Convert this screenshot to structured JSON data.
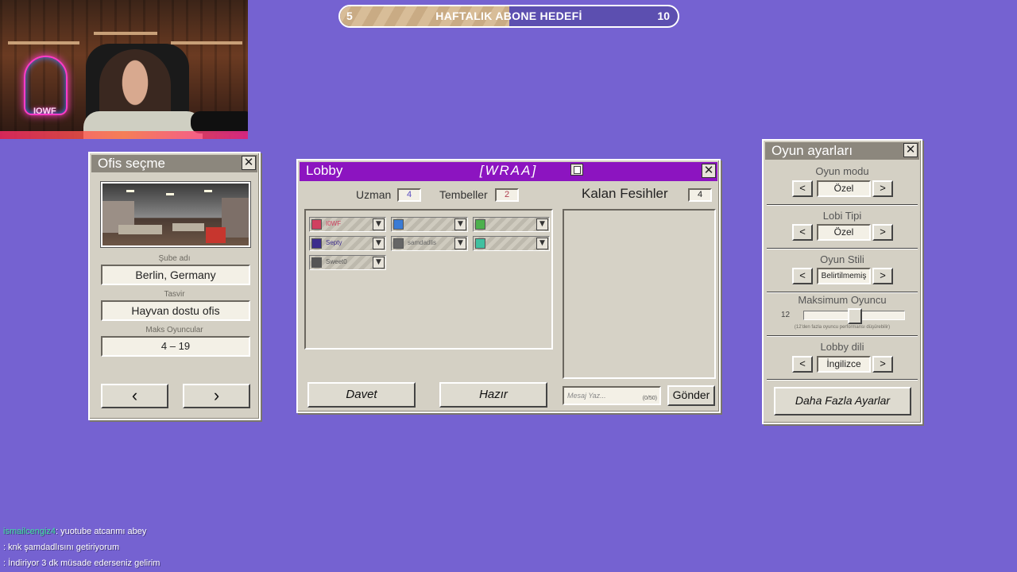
{
  "goal": {
    "left": "5",
    "label": "HAFTALIK ABONE HEDEFİ",
    "right": "10",
    "progress_fraction": 0.5
  },
  "webcam": {
    "neon_text": "IOWF"
  },
  "ofis": {
    "title": "Ofis seçme",
    "branch_label": "Şube adı",
    "branch_value": "Berlin, Germany",
    "desc_label": "Tasvir",
    "desc_value": "Hayvan dostu ofis",
    "max_label": "Maks Oyuncular",
    "max_value": "4 – 19",
    "prev": "‹",
    "next": "›"
  },
  "lobby": {
    "title": "Lobby",
    "code": "[WRAA]",
    "uzman_label": "Uzman",
    "uzman_value": "4",
    "tembel_label": "Tembeller",
    "tembel_value": "2",
    "kalan_label": "Kalan Fesihler",
    "kalan_value": "4",
    "players": [
      {
        "name": "I0WF",
        "color": "#d04060"
      },
      {
        "name": "",
        "color": "#3a7bd5"
      },
      {
        "name": "",
        "color": "#4db04d"
      },
      {
        "name": "Septy",
        "color": "#3b2c8c"
      },
      {
        "name": "samdadlis",
        "color": "#666666"
      },
      {
        "name": "",
        "color": "#40c0a0"
      },
      {
        "name": "Sweet0",
        "color": "#555555"
      }
    ],
    "invite": "Davet",
    "ready": "Hazır",
    "msg_placeholder": "Mesaj Yaz...",
    "msg_count": "(0/50)",
    "send": "Gönder"
  },
  "oyun": {
    "title": "Oyun ayarları",
    "mode_label": "Oyun modu",
    "mode_value": "Özel",
    "lobby_type_label": "Lobi Tipi",
    "lobby_type_value": "Özel",
    "style_label": "Oyun Stili",
    "style_value": "Belirtilmemiş",
    "max_players_label": "Maksimum Oyuncu",
    "max_players_value": "12",
    "max_players_fraction": 0.5,
    "max_players_note": "(12'den fazla oyuncu performansı düşürebilir)",
    "lang_label": "Lobby dili",
    "lang_value": "İngilizce",
    "more": "Daha Fazla Ayarlar",
    "left_arrow": "<",
    "right_arrow": ">"
  },
  "chat": [
    {
      "user": "ismailcengiz4",
      "user_color": "#3fe0a0",
      "text": ": yuotube atcanmı abey"
    },
    {
      "user": "",
      "user_color": "#4fa0ff",
      "text": ": knk şamdadlısını getiriyorum"
    },
    {
      "user": "",
      "user_color": "#5aa0ff",
      "text": ": İndiriyor 3 dk müsade ederseniz gelirim"
    }
  ]
}
